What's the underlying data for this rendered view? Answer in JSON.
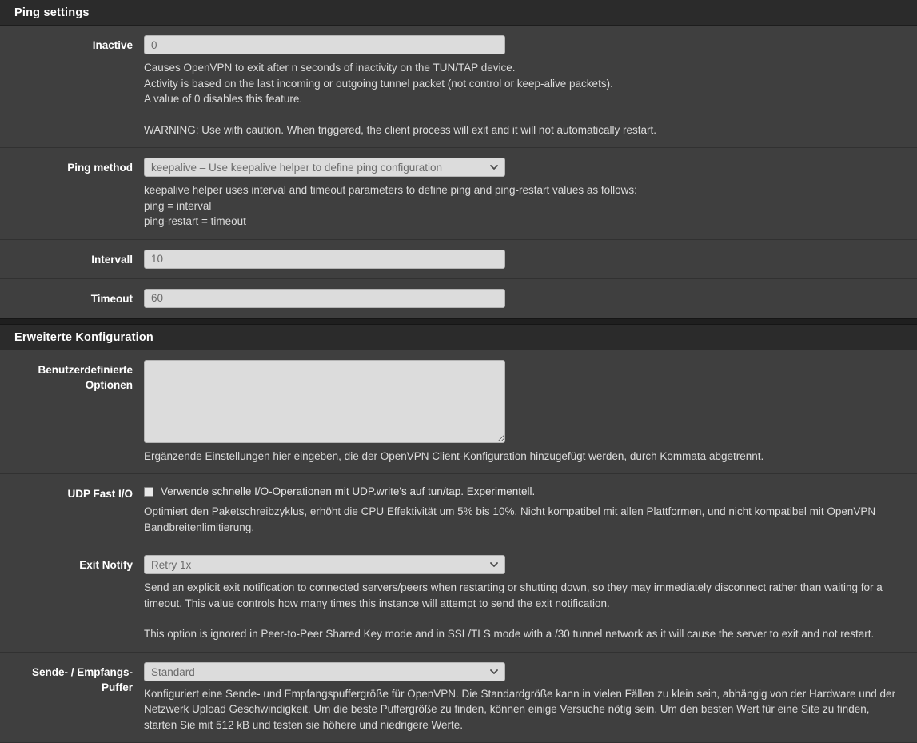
{
  "sections": [
    {
      "id": "ping-settings",
      "title": "Ping settings",
      "rows": [
        {
          "id": "inactive",
          "label": "Inactive",
          "control": "text",
          "value": "0",
          "help": [
            "Causes OpenVPN to exit after n seconds of inactivity on the TUN/TAP device.",
            "Activity is based on the last incoming or outgoing tunnel packet (not control or keep-alive packets).",
            "A value of 0 disables this feature.",
            "WARNING: Use with caution. When triggered, the client process will exit and it will not automatically restart."
          ]
        },
        {
          "id": "ping-method",
          "label": "Ping method",
          "control": "select",
          "value": "keepalive – Use keepalive helper to define ping configuration",
          "options": [
            "keepalive – Use keepalive helper to define ping configuration"
          ],
          "help": [
            "keepalive helper uses interval and timeout parameters to define ping and ping-restart values as follows:",
            "ping = interval",
            "ping-restart = timeout"
          ]
        },
        {
          "id": "intervall",
          "label": "Intervall",
          "control": "text",
          "value": "10",
          "help": []
        },
        {
          "id": "timeout",
          "label": "Timeout",
          "control": "text",
          "value": "60",
          "help": []
        }
      ]
    },
    {
      "id": "erweiterte-konfiguration",
      "title": "Erweiterte Konfiguration",
      "rows": [
        {
          "id": "benutzerdefinierte-optionen",
          "label": "Benutzerdefinierte Optionen",
          "label_line1": "Benutzerdefinierte",
          "label_line2": "Optionen",
          "control": "textarea",
          "value": "",
          "help": [
            "Ergänzende Einstellungen hier eingeben, die der OpenVPN Client-Konfiguration hinzugefügt werden, durch Kommata abgetrennt."
          ]
        },
        {
          "id": "udp-fast-io",
          "label": "UDP Fast I/O",
          "control": "checkbox",
          "checked": false,
          "checkbox_label": "Verwende schnelle I/O-Operationen mit UDP.write's auf tun/tap. Experimentell.",
          "help": [
            "Optimiert den Paketschreibzyklus, erhöht die CPU Effektivität um 5% bis 10%. Nicht kompatibel mit allen Plattformen, und nicht kompatibel mit OpenVPN Bandbreitenlimitierung."
          ]
        },
        {
          "id": "exit-notify",
          "label": "Exit Notify",
          "control": "select",
          "value": "Retry 1x",
          "options": [
            "Retry 1x"
          ],
          "help": [
            "Send an explicit exit notification to connected servers/peers when restarting or shutting down, so they may immediately disconnect rather than waiting for a timeout. This value controls how many times this instance will attempt to send the exit notification.",
            "This option is ignored in Peer-to-Peer Shared Key mode and in SSL/TLS mode with a /30 tunnel network as it will cause the server to exit and not restart."
          ]
        },
        {
          "id": "sende-empfangs-puffer",
          "label": "Sende- / Empfangs- Puffer",
          "label_line1": "Sende- / Empfangs-",
          "label_line2": "Puffer",
          "control": "select",
          "value": "Standard",
          "options": [
            "Standard"
          ],
          "help": [
            "Konfiguriert eine Sende- und Empfangspuffergröße für OpenVPN. Die Standardgröße kann in vielen Fällen zu klein sein, abhängig von der Hardware und der Netzwerk Upload Geschwindigkeit. Um die beste Puffergröße zu finden, können einige Versuche nötig sein. Um den besten Wert für eine Site zu finden, starten Sie mit 512 kB und testen sie höhere und niedrigere Werte."
          ]
        }
      ]
    }
  ],
  "colors": {
    "background": "#3f3f3f",
    "header_background": "#2b2b2b",
    "gap": "#1f1f1f",
    "label_text": "#ffffff",
    "help_text": "#dcdcdc",
    "input_background": "#dcdcdc",
    "input_text": "#6a6a6a",
    "divider": "#313131"
  },
  "icons": {
    "chevron_down": "chevron-down-icon",
    "resize_grip": "resize-grip-icon"
  }
}
